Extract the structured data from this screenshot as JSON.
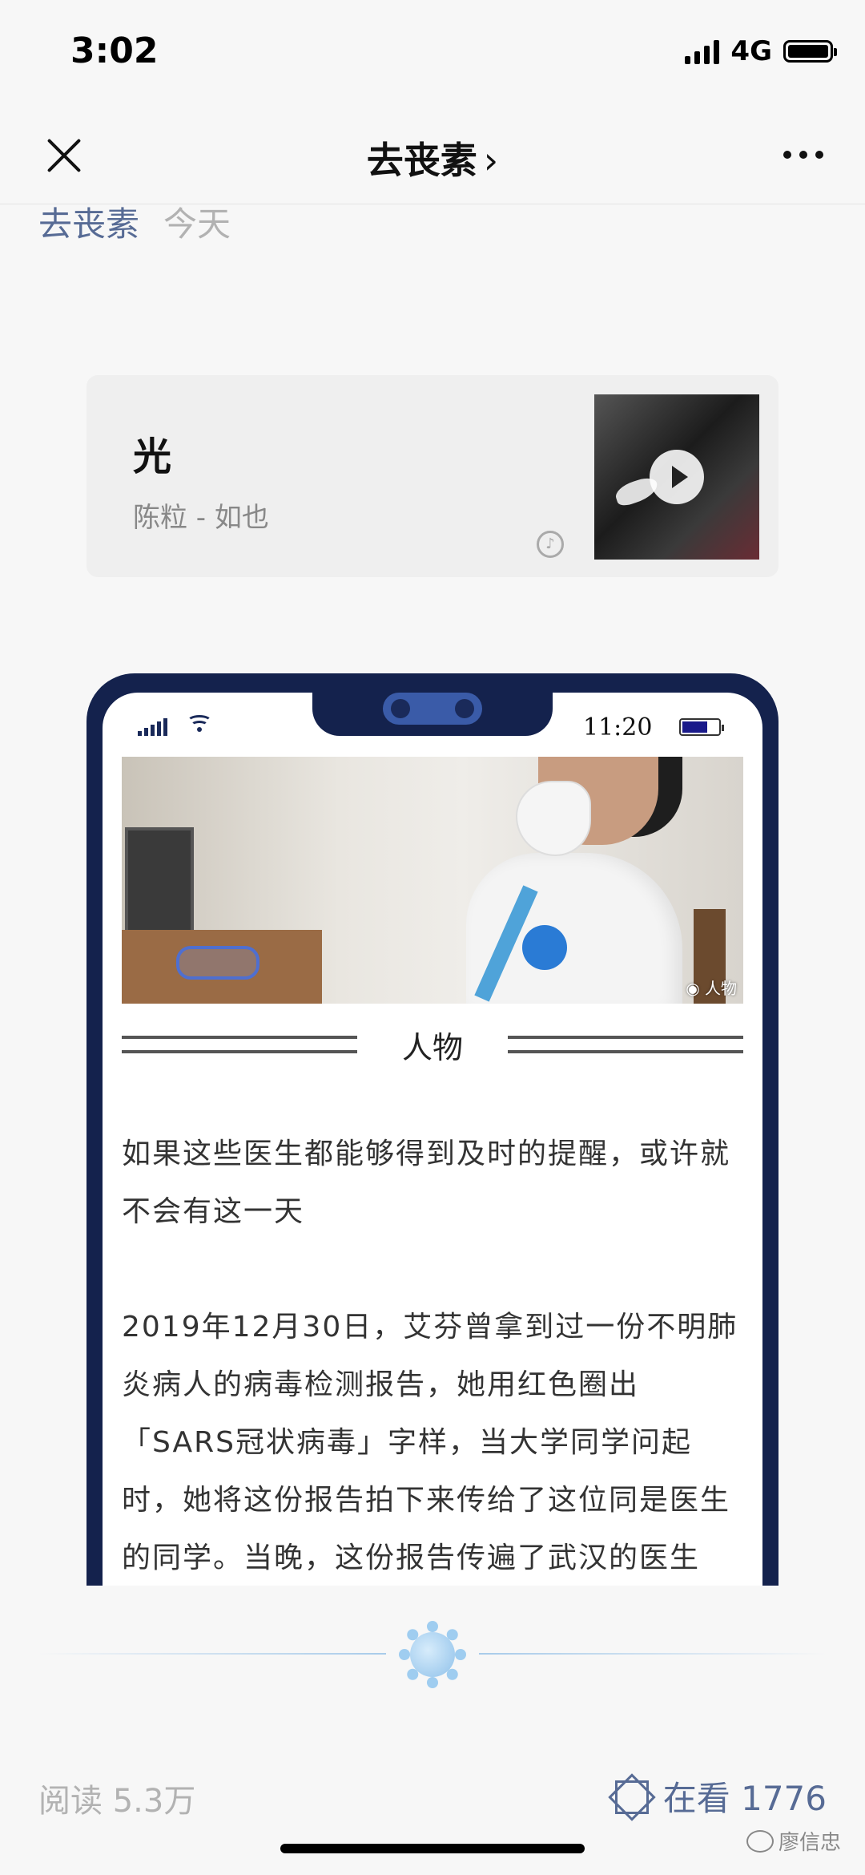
{
  "status_bar": {
    "time": "3:02",
    "network": "4G"
  },
  "nav": {
    "title": "去丧素",
    "chevron": "›"
  },
  "meta": {
    "account": "去丧素",
    "date": "今天"
  },
  "music": {
    "title": "光",
    "artist": "陈粒 - 如也"
  },
  "mock_phone": {
    "time": "11:20"
  },
  "photo": {
    "credit": "人物"
  },
  "section": {
    "title": "人物"
  },
  "article": {
    "paragraphs": [
      "如果这些医生都能够得到及时的提醒，或许就不会有这一天",
      "2019年12月30日，艾芬曾拿到过一份不明肺炎病人的病毒检测报告，她用红色圈出「SARS冠状病毒」字样，当大学同学问起时，她将这份报告拍下来传给了这位同是医生的同学。当晚，这份报告传遍了武汉的医生圈，被发这份报告的人就包括"
    ]
  },
  "footer": {
    "read_count": "阅读 5.3万",
    "watching": "在看 1776",
    "watermark": "廖信忠"
  },
  "colors": {
    "link": "#576b95",
    "frame": "#14224d"
  }
}
